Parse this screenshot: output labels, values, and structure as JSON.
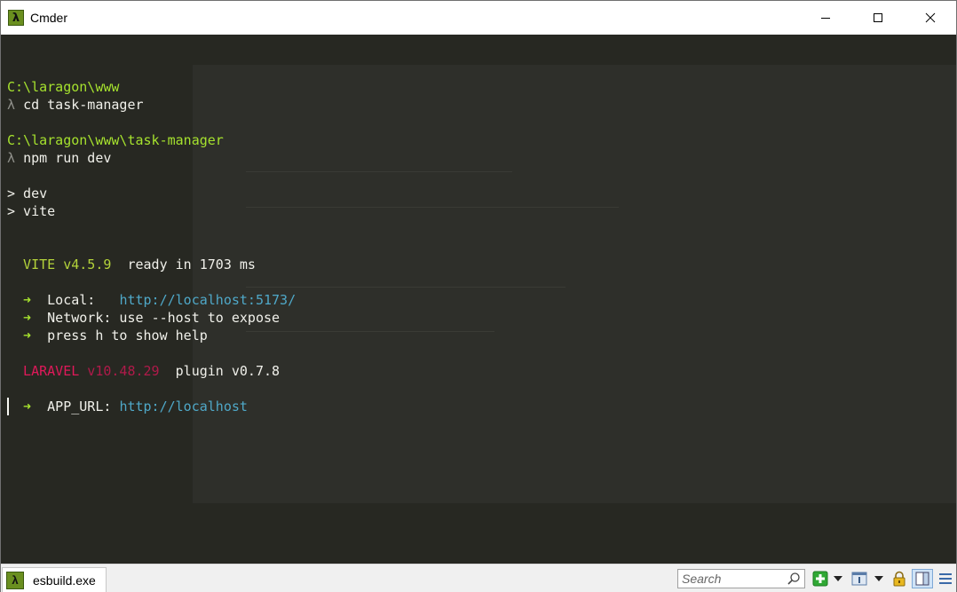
{
  "window": {
    "title": "Cmder"
  },
  "terminal": {
    "lines": [
      [],
      [
        {
          "t": "C:\\laragon\\www",
          "c": "green"
        }
      ],
      [
        {
          "t": "λ ",
          "c": "lambda"
        },
        {
          "t": "cd task-manager",
          "c": "white"
        }
      ],
      [],
      [
        {
          "t": "C:\\laragon\\www\\task-manager",
          "c": "green"
        }
      ],
      [
        {
          "t": "λ ",
          "c": "lambda"
        },
        {
          "t": "npm run dev",
          "c": "white"
        }
      ],
      [],
      [
        {
          "t": "> dev",
          "c": "white"
        }
      ],
      [
        {
          "t": "> vite",
          "c": "white"
        }
      ],
      [],
      [],
      [
        {
          "t": "  VITE v4.5.9",
          "c": "yellowgreen"
        },
        {
          "t": "  ready in ",
          "c": "white"
        },
        {
          "t": "1703",
          "c": "white"
        },
        {
          "t": " ms",
          "c": "white"
        }
      ],
      [],
      [
        {
          "t": "  ➜",
          "c": "green"
        },
        {
          "t": "  Local:   ",
          "c": "white"
        },
        {
          "t": "http://localhost:",
          "c": "cyan"
        },
        {
          "t": "5173",
          "c": "cyan"
        },
        {
          "t": "/",
          "c": "cyan"
        }
      ],
      [
        {
          "t": "  ➜",
          "c": "green"
        },
        {
          "t": "  Network: use ",
          "c": "white"
        },
        {
          "t": "--host",
          "c": "white"
        },
        {
          "t": " to expose",
          "c": "white"
        }
      ],
      [
        {
          "t": "  ➜",
          "c": "green"
        },
        {
          "t": "  press ",
          "c": "white"
        },
        {
          "t": "h",
          "c": "white"
        },
        {
          "t": " to show help",
          "c": "white"
        }
      ],
      [],
      [
        {
          "t": "  LARAVEL",
          "c": "red"
        },
        {
          "t": " v10.48.29",
          "c": "dimred"
        },
        {
          "t": "  plugin ",
          "c": "white"
        },
        {
          "t": "v0.7.8",
          "c": "white"
        }
      ],
      [],
      [
        {
          "t": "  ➜",
          "c": "green"
        },
        {
          "t": "  APP_URL: ",
          "c": "white"
        },
        {
          "t": "http://localhost",
          "c": "cyan"
        }
      ]
    ]
  },
  "statusbar": {
    "tab_label": "esbuild.exe",
    "search_placeholder": "Search"
  },
  "colors": {
    "background": "#272822",
    "prompt_path": "#a6e22e",
    "url": "#4fa8c8",
    "laravel": "#e0195a"
  }
}
